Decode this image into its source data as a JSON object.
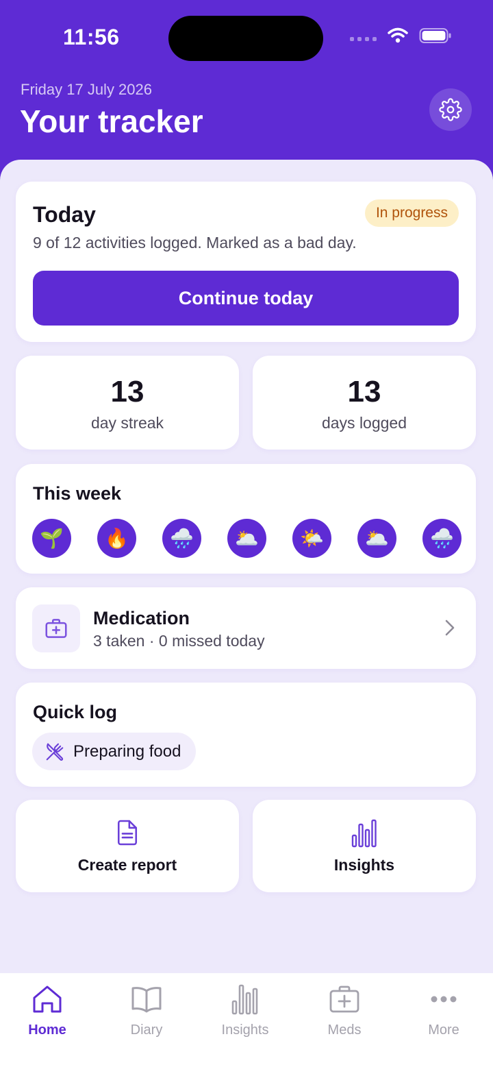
{
  "status_bar": {
    "time": "11:56"
  },
  "header": {
    "date": "Friday 17 July 2026",
    "title": "Your tracker"
  },
  "today": {
    "title": "Today",
    "badge": "In progress",
    "summary": "9 of 12 activities logged. Marked as a bad day.",
    "continue_label": "Continue today"
  },
  "stats": [
    {
      "value": "13",
      "label": "day streak"
    },
    {
      "value": "13",
      "label": "days logged"
    }
  ],
  "week": {
    "title": "This week",
    "days": [
      "🌱",
      "🔥",
      "🌧️",
      "🌥️",
      "🌤️",
      "🌥️",
      "🌧️"
    ]
  },
  "medication": {
    "title": "Medication",
    "summary": "3 taken · 0 missed today"
  },
  "quick_log": {
    "title": "Quick log",
    "chip_label": "Preparing food"
  },
  "actions": [
    {
      "label": "Create report",
      "icon": "document-icon"
    },
    {
      "label": "Insights",
      "icon": "bar-chart-icon"
    }
  ],
  "tabbar": [
    {
      "label": "Home",
      "icon": "home-icon",
      "active": true
    },
    {
      "label": "Diary",
      "icon": "book-icon",
      "active": false
    },
    {
      "label": "Insights",
      "icon": "bar-chart-icon",
      "active": false
    },
    {
      "label": "Meds",
      "icon": "medkit-icon",
      "active": false
    },
    {
      "label": "More",
      "icon": "more-icon",
      "active": false
    }
  ],
  "colors": {
    "brand": "#5E2BD4",
    "background": "#EDE9FB",
    "badge_bg": "#FDEFC7",
    "badge_text": "#B0530B",
    "inactive_tab": "#A4A2AC"
  }
}
